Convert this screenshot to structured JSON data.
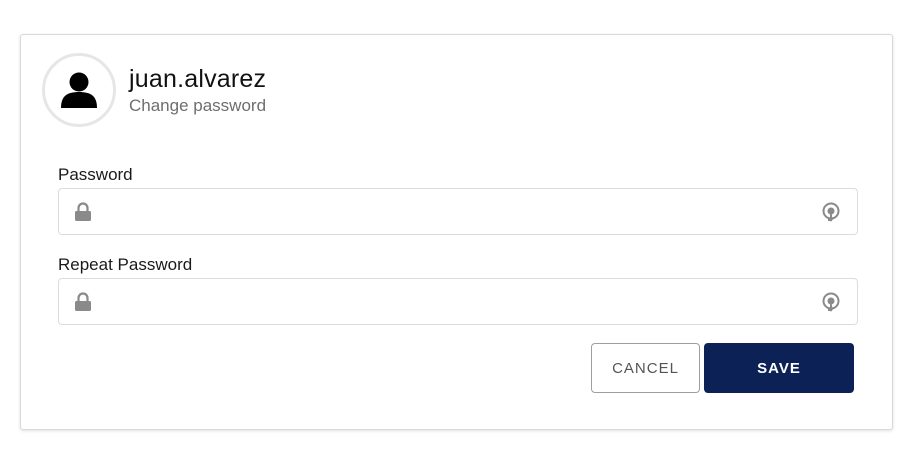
{
  "header": {
    "username": "juan.alvarez",
    "subtitle": "Change password",
    "avatar_icon": "user-icon"
  },
  "fields": {
    "password": {
      "label": "Password",
      "value": "",
      "placeholder": "",
      "leading_icon": "lock-icon",
      "trailing_icon": "reveal-password-icon"
    },
    "repeat_password": {
      "label": "Repeat Password",
      "value": "",
      "placeholder": "",
      "leading_icon": "lock-icon",
      "trailing_icon": "reveal-password-icon"
    }
  },
  "actions": {
    "cancel_label": "CANCEL",
    "save_label": "SAVE"
  },
  "colors": {
    "primary": "#0c2257",
    "icon_gray": "#8a8a8a",
    "border": "#dcdcdc"
  }
}
